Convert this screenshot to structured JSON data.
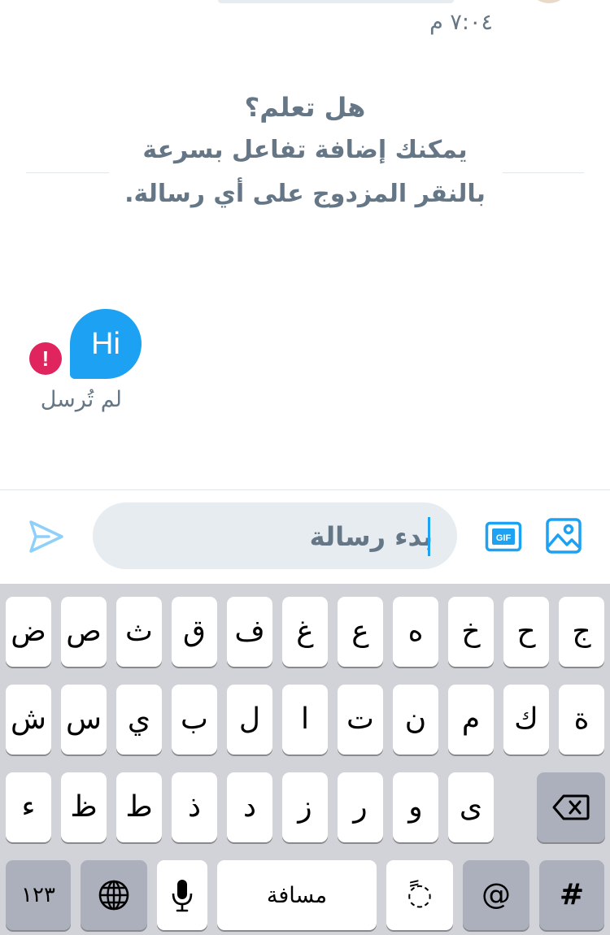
{
  "conversation": {
    "timestamp": "٧:٠٤ م",
    "tip": {
      "title": "هل تعلم؟",
      "line1": "يمكنك إضافة تفاعل بسرعة",
      "line2": "بالنقر المزدوج على أي رسالة."
    },
    "message": {
      "text": "Hi",
      "status": "لم تُرسل",
      "status_icon": "error-icon",
      "bubble_color": "#1da1f2",
      "error_color": "#e0245e"
    }
  },
  "composer": {
    "placeholder": "بدء رسالة",
    "send_icon": "send-icon",
    "gif_icon": "gif-icon",
    "image_icon": "image-icon",
    "accent": "#1da1f2"
  },
  "keyboard": {
    "row1": [
      "ض",
      "ص",
      "ث",
      "ق",
      "ف",
      "غ",
      "ع",
      "ه",
      "خ",
      "ح",
      "ج"
    ],
    "row2": [
      "ش",
      "س",
      "ي",
      "ب",
      "ل",
      "ا",
      "ت",
      "ن",
      "م",
      "ك",
      "ة"
    ],
    "row3": [
      "ء",
      "ظ",
      "ط",
      "ذ",
      "د",
      "ز",
      "ر",
      "و",
      "ى"
    ],
    "backspace_icon": "backspace-icon",
    "numbers_label": "١٢٣",
    "globe_icon": "globe-icon",
    "mic_icon": "microphone-icon",
    "space_label": "مسافة",
    "diacritic_label": "◌ً",
    "at_label": "@",
    "hash_label": "#"
  }
}
